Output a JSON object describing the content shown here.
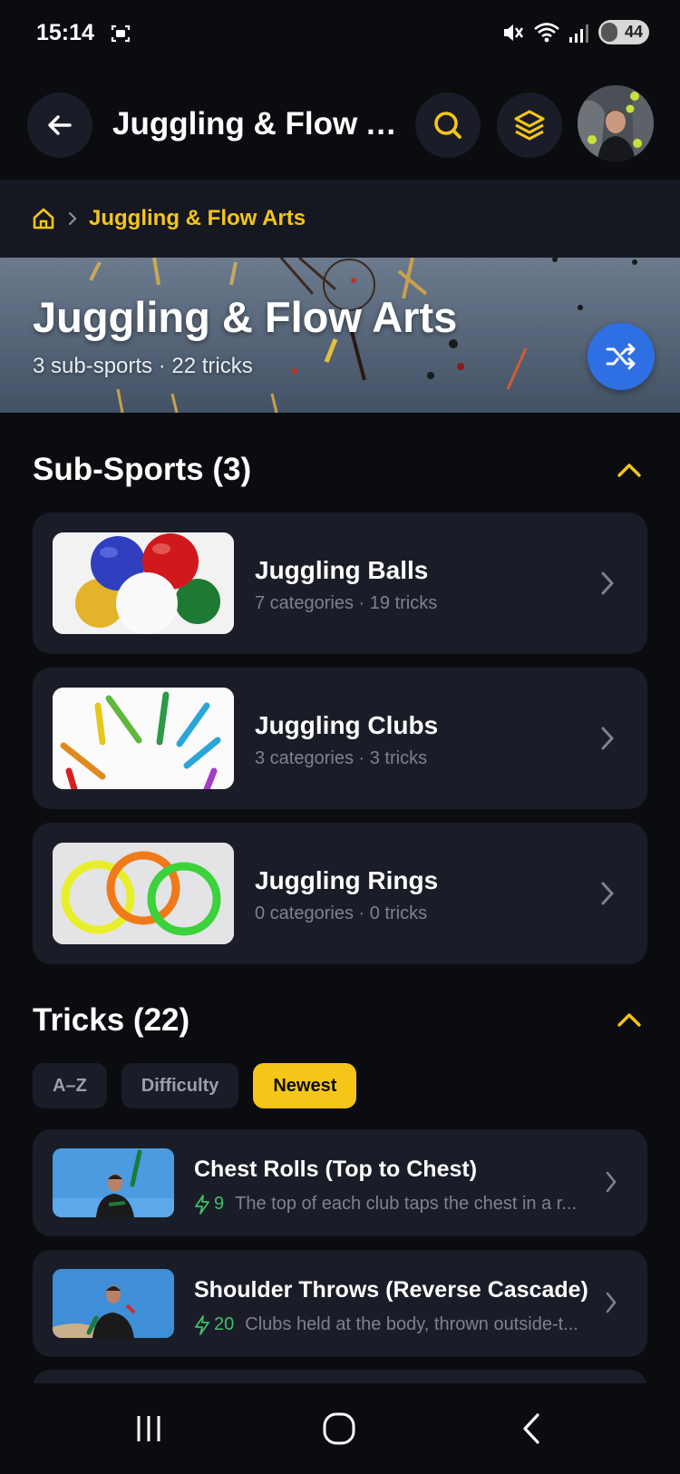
{
  "status_bar": {
    "time": "15:14",
    "battery": "44"
  },
  "app_bar": {
    "title": "Juggling & Flow A..."
  },
  "breadcrumb": {
    "current": "Juggling & Flow Arts"
  },
  "hero": {
    "title": "Juggling & Flow Arts",
    "subtitle": "3 sub-sports · 22 tricks"
  },
  "sub_sports": {
    "header": "Sub-Sports (3)",
    "items": [
      {
        "title": "Juggling Balls",
        "subtitle": "7 categories · 19 tricks",
        "thumb": "juggling-balls"
      },
      {
        "title": "Juggling Clubs",
        "subtitle": "3 categories · 3 tricks",
        "thumb": "juggling-clubs"
      },
      {
        "title": "Juggling Rings",
        "subtitle": "0 categories · 0 tricks",
        "thumb": "juggling-rings"
      }
    ]
  },
  "tricks": {
    "header": "Tricks (22)",
    "filters": [
      "A–Z",
      "Difficulty",
      "Newest"
    ],
    "active_filter": "Newest",
    "items": [
      {
        "title": "Chest Rolls (Top to Chest)",
        "points": "9",
        "description": "The top of each club taps the chest in a r..."
      },
      {
        "title": "Shoulder Throws (Reverse Cascade)",
        "points": "20",
        "description": "Clubs held at the body, thrown outside-t..."
      }
    ]
  },
  "colors": {
    "accent": "#f5c518",
    "background": "#0b0c10",
    "card": "#1a1d27",
    "shuffle": "#2f6fe4",
    "points": "#3fbf6a"
  },
  "icons": {
    "back": "arrow-left-icon",
    "search": "search-icon",
    "layers": "layers-icon",
    "home": "home-icon",
    "shuffle": "shuffle-icon",
    "collapse": "chevron-up-icon",
    "chevron": "chevron-right-icon",
    "points": "bolt-icon"
  }
}
